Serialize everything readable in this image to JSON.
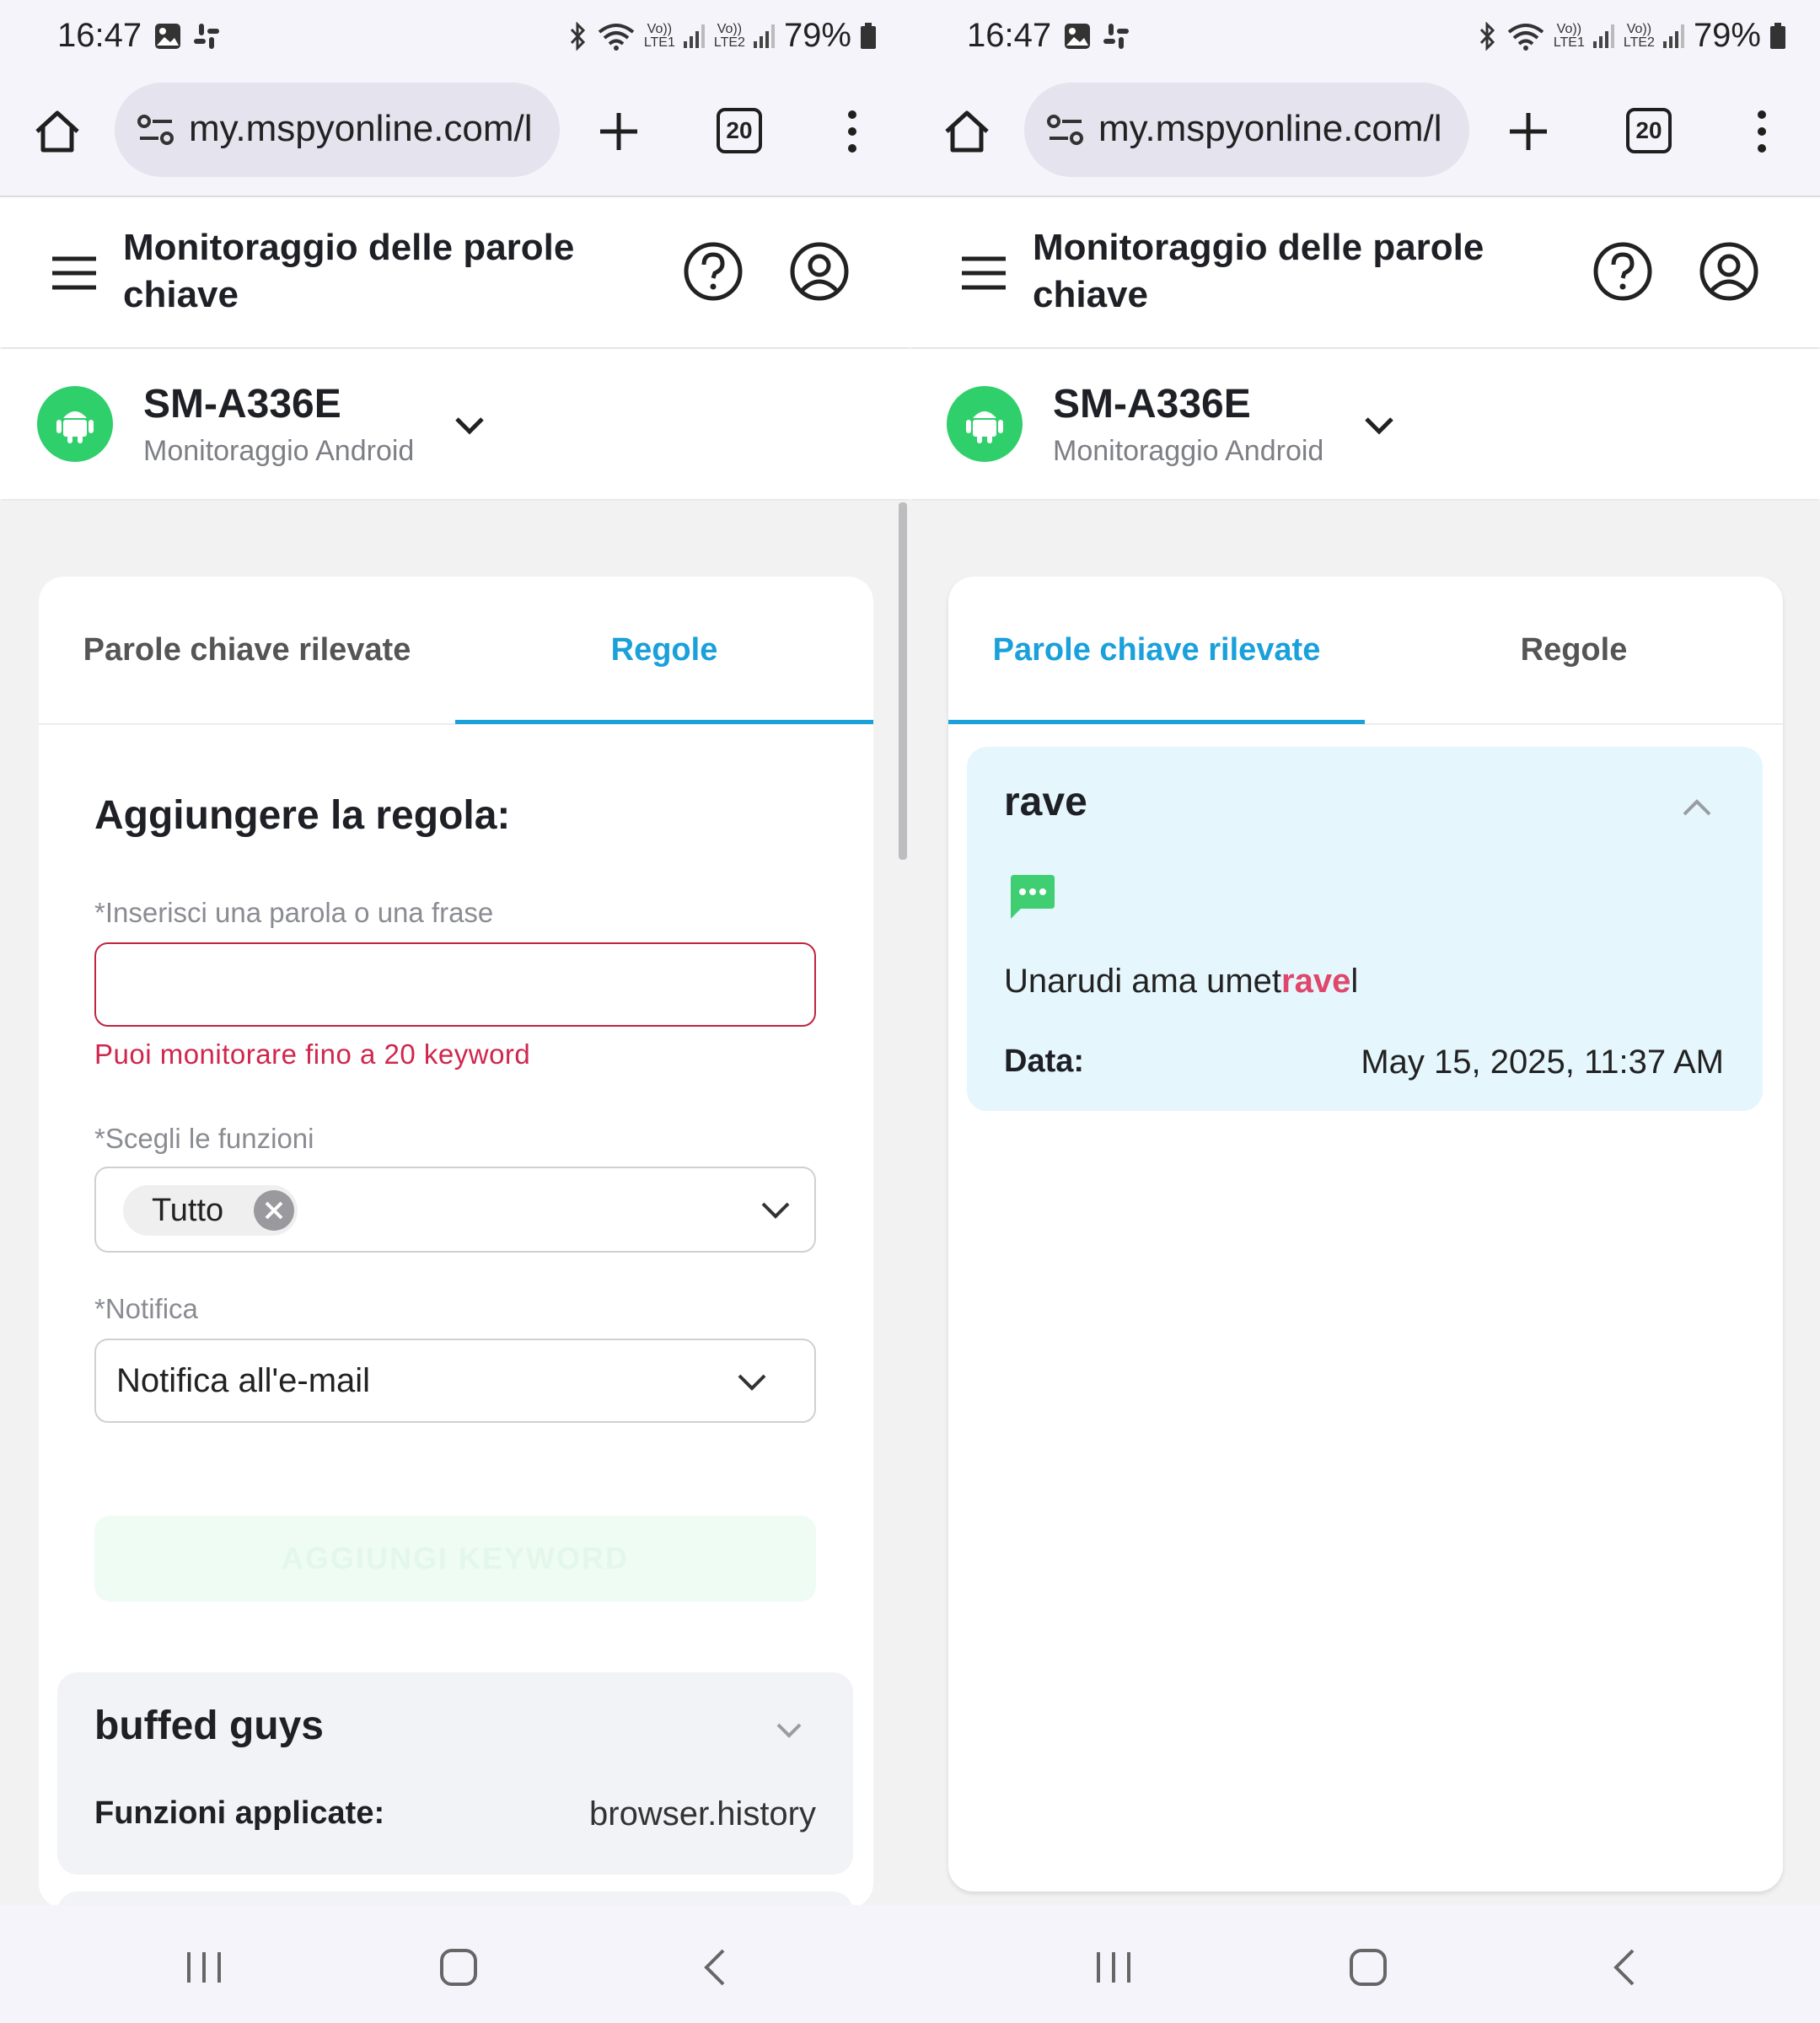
{
  "status_bar": {
    "time": "16:47",
    "net1": "Vo))\nLTE1",
    "net2": "Vo))\nLTE2",
    "battery": "79%"
  },
  "browser": {
    "url": "my.mspyonline.com/l",
    "tab_count": "20"
  },
  "app": {
    "title": "Monitoraggio delle parole chiave"
  },
  "device": {
    "name": "SM-A336E",
    "subtitle": "Monitoraggio Android"
  },
  "tabs": {
    "detected": "Parole chiave rilevate",
    "rules": "Regole"
  },
  "left": {
    "form_title": "Aggiungere la regola:",
    "keyword_label": "*Inserisci una parola o una frase",
    "keyword_value": "",
    "keyword_error": "Puoi monitorare fino a 20 keyword",
    "functions_label": "*Scegli le funzioni",
    "functions_chip": "Tutto",
    "notify_label": "*Notifica",
    "notify_value": "Notifica all'e-mail",
    "add_button": "AGGIUNGI KEYWORD",
    "rule": {
      "title": "buffed guys",
      "key": "Funzioni applicate:",
      "value": "browser.history"
    }
  },
  "right": {
    "keyword": "rave",
    "message_before": "Unarudi ama umet",
    "message_highlight": "rave",
    "message_after": "l",
    "date_key": "Data:",
    "date_value": "May 15, 2025, 11:37 AM"
  },
  "colors": {
    "accent": "#1aa0da",
    "android_green": "#2fcf6b",
    "error": "#d0264d",
    "highlight": "#e0476a",
    "detected_bg": "#e5f6fd"
  }
}
